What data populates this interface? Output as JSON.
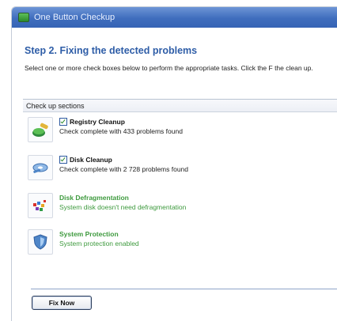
{
  "window": {
    "title": "One Button Checkup"
  },
  "step": {
    "title": "Step 2. Fixing the detected problems",
    "instructions": "Select one or more check boxes below to perform the appropriate tasks. Click the F the clean up."
  },
  "sections": {
    "header": "Check up sections",
    "items": [
      {
        "icon": "broom-icon",
        "title": "Registry Cleanup",
        "status": "Check complete with 433 problems found",
        "checked": true
      },
      {
        "icon": "disk-cleanup-icon",
        "title": "Disk Cleanup",
        "status": "Check complete with 2 728 problems found",
        "checked": true
      },
      {
        "icon": "defrag-icon",
        "title": "Disk Defragmentation",
        "status": "System disk doesn't need defragmentation",
        "checked": false
      },
      {
        "icon": "shield-icon",
        "title": "System Protection",
        "status": "System protection enabled",
        "checked": false
      }
    ]
  },
  "actions": {
    "fix_now": "Fix Now"
  },
  "colors": {
    "accent": "#2e5da7",
    "ok_green": "#3e9a3e",
    "titlebar": "#3f6dbd"
  }
}
